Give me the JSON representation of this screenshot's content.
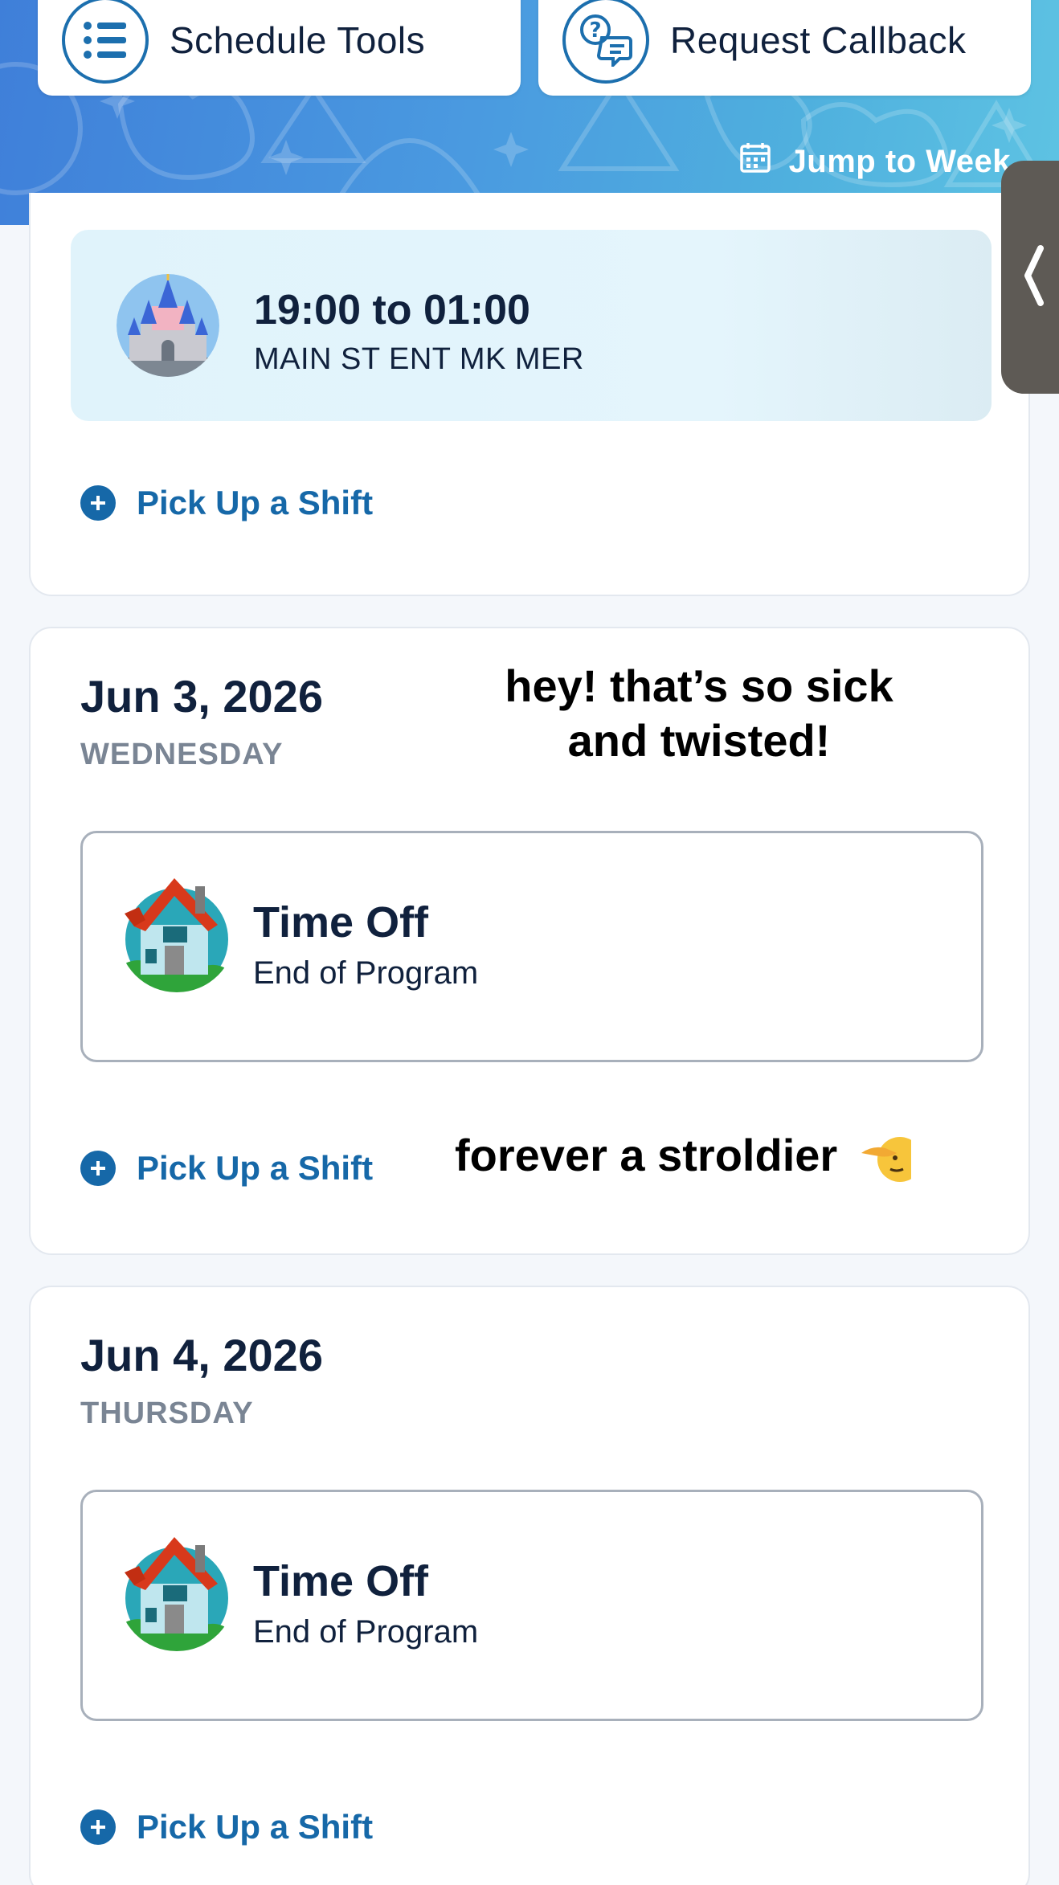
{
  "header": {
    "schedule_tools_label": "Schedule Tools",
    "request_callback_label": "Request Callback",
    "jump_to_week_label": "Jump to Week"
  },
  "days": [
    {
      "shift": {
        "time": "19:00 to 01:00",
        "location": "MAIN ST ENT MK MER"
      },
      "pickup_label": "Pick Up a Shift"
    },
    {
      "date": "Jun 3, 2026",
      "weekday": "WEDNESDAY",
      "entry": {
        "title": "Time Off",
        "subtitle": "End of Program"
      },
      "pickup_label": "Pick Up a Shift"
    },
    {
      "date": "Jun 4, 2026",
      "weekday": "THURSDAY",
      "entry": {
        "title": "Time Off",
        "subtitle": "End of Program"
      },
      "pickup_label": "Pick Up a Shift"
    }
  ],
  "overlay": {
    "caption_1_line_1": "hey! that’s so sick",
    "caption_1_line_2": "and twisted!",
    "caption_2": "forever a stroldier",
    "caption_2_emoji": "saluting-face-emoji"
  },
  "colors": {
    "banner_start": "#3f7fd9",
    "banner_end": "#5ec3e3",
    "accent_blue": "#1668a8",
    "text_dark": "#10213d",
    "weekday_gray": "#7a8594"
  }
}
